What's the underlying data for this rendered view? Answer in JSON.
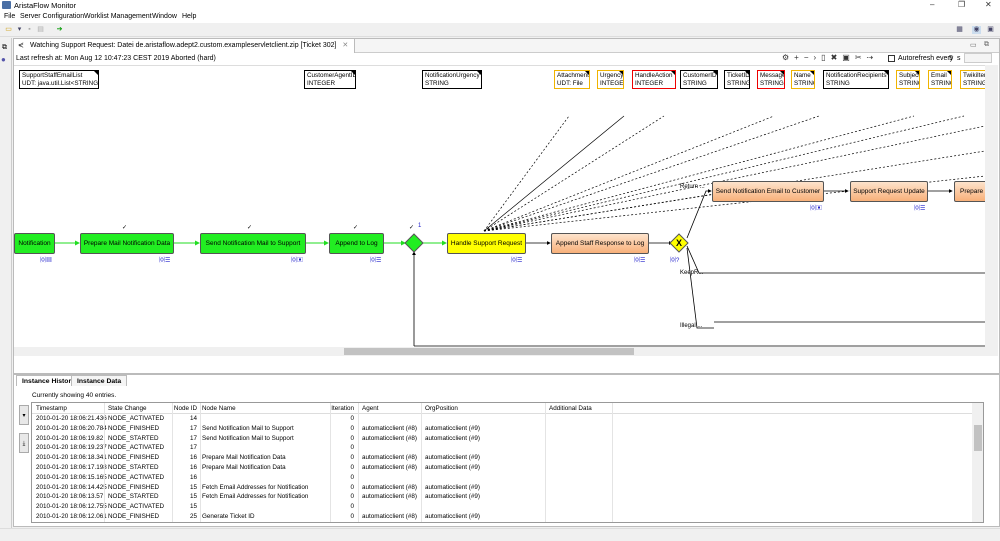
{
  "app": {
    "title": "AristaFlow Monitor"
  },
  "menu": [
    "File",
    "Server Configuration",
    "Worklist Management",
    "Window",
    "Help"
  ],
  "editor": {
    "tab_title": "Watching Support Request: Datei de.aristaflow.adept2.custom.exampleservletclient.zip [Ticket 302]",
    "info": "Last refresh at: Mon Aug 12 10:47:23 CEST 2019  Aborted (hard)",
    "autorefresh_label": "Autorefresh every",
    "autorefresh_value": "5",
    "autorefresh_unit": "s"
  },
  "data_elements": [
    {
      "name": "SupportStaffEmailList",
      "type": "UDT: java.util.List<STRING>",
      "color": "#000000"
    },
    {
      "name": "CustomerAgentID",
      "type": "INTEGER",
      "color": "#000000"
    },
    {
      "name": "NotificationUrgency",
      "type": "STRING",
      "color": "#000000"
    },
    {
      "name": "Attachment",
      "type": "UDT: File",
      "color": "#f0b400"
    },
    {
      "name": "Urgency",
      "type": "INTEGER",
      "color": "#f0b400"
    },
    {
      "name": "HandleAction",
      "type": "INTEGER",
      "color": "#ee0000"
    },
    {
      "name": "CustomerID",
      "type": "STRING",
      "color": "#000000"
    },
    {
      "name": "TicketID",
      "type": "STRING",
      "color": "#000000"
    },
    {
      "name": "Message",
      "type": "STRING",
      "color": "#ee0000"
    },
    {
      "name": "Name",
      "type": "STRING",
      "color": "#f0b400"
    },
    {
      "name": "NotificationRecipients",
      "type": "STRING",
      "color": "#000000"
    },
    {
      "name": "Subject",
      "type": "STRING",
      "color": "#f0b400"
    },
    {
      "name": "Email",
      "type": "STRING",
      "color": "#f0b400"
    },
    {
      "name": "TwikiItem",
      "type": "STRING",
      "color": "#f0b400"
    }
  ],
  "nodes": [
    {
      "label": "Notification",
      "state": "finished"
    },
    {
      "label": "Prepare Mail Notification Data",
      "state": "finished"
    },
    {
      "label": "Send Notification Mail to Support",
      "state": "finished"
    },
    {
      "label": "Append to Log",
      "state": "finished"
    },
    {
      "label": "Handle Support Request",
      "state": "activated"
    },
    {
      "label": "Append Staff Response to Log",
      "state": "not_activated"
    },
    {
      "label": "Send Notification Email to Customer",
      "state": "not_activated"
    },
    {
      "label": "Support Request Update",
      "state": "not_activated"
    },
    {
      "label": "Prepare M",
      "state": "not_activated"
    }
  ],
  "branch_labels": [
    "Return ...",
    "KeepR...",
    "Illegal ..."
  ],
  "loop_count": "1",
  "state_colors": {
    "finished": "#22ee22",
    "activated": "#ffff00",
    "not_activated": "#f8b07a"
  },
  "bottom": {
    "tabs": [
      "Instance History",
      "Instance Data"
    ],
    "status": "Currently showing 40 entries.",
    "columns": [
      "Timestamp",
      "State Change",
      "Node ID",
      "Node Name",
      "Iteration",
      "Agent",
      "OrgPosition",
      "Additional Data"
    ],
    "rows": [
      [
        "2010-01-20 18:06:21.436",
        "NODE_ACTIVATED",
        "14",
        "",
        "0",
        "",
        ""
      ],
      [
        "2010-01-20 18:06:20.784",
        "NODE_FINISHED",
        "17",
        "Send Notification Mail to Support",
        "0",
        "automaticclient (#8)",
        "automaticclient (#9)"
      ],
      [
        "2010-01-20 18:06:19.82",
        "NODE_STARTED",
        "17",
        "Send Notification Mail to Support",
        "0",
        "automaticclient (#8)",
        "automaticclient (#9)"
      ],
      [
        "2010-01-20 18:06:19.237",
        "NODE_ACTIVATED",
        "17",
        "",
        "0",
        "",
        ""
      ],
      [
        "2010-01-20 18:06:18.341",
        "NODE_FINISHED",
        "16",
        "Prepare Mail Notification Data",
        "0",
        "automaticclient (#8)",
        "automaticclient (#9)"
      ],
      [
        "2010-01-20 18:06:17.198",
        "NODE_STARTED",
        "16",
        "Prepare Mail Notification Data",
        "0",
        "automaticclient (#8)",
        "automaticclient (#9)"
      ],
      [
        "2010-01-20 18:06:15.165",
        "NODE_ACTIVATED",
        "16",
        "",
        "0",
        "",
        ""
      ],
      [
        "2010-01-20 18:06:14.425",
        "NODE_FINISHED",
        "15",
        "Fetch Email Addresses for Notification",
        "0",
        "automaticclient (#8)",
        "automaticclient (#9)"
      ],
      [
        "2010-01-20 18:06:13.57",
        "NODE_STARTED",
        "15",
        "Fetch Email Addresses for Notification",
        "0",
        "automaticclient (#8)",
        "automaticclient (#9)"
      ],
      [
        "2010-01-20 18:06:12.755",
        "NODE_ACTIVATED",
        "15",
        "",
        "0",
        "",
        ""
      ],
      [
        "2010-01-20 18:06:12.061",
        "NODE_FINISHED",
        "25",
        "Generate Ticket ID",
        "0",
        "automaticclient (#8)",
        "automaticclient (#9)"
      ]
    ]
  }
}
